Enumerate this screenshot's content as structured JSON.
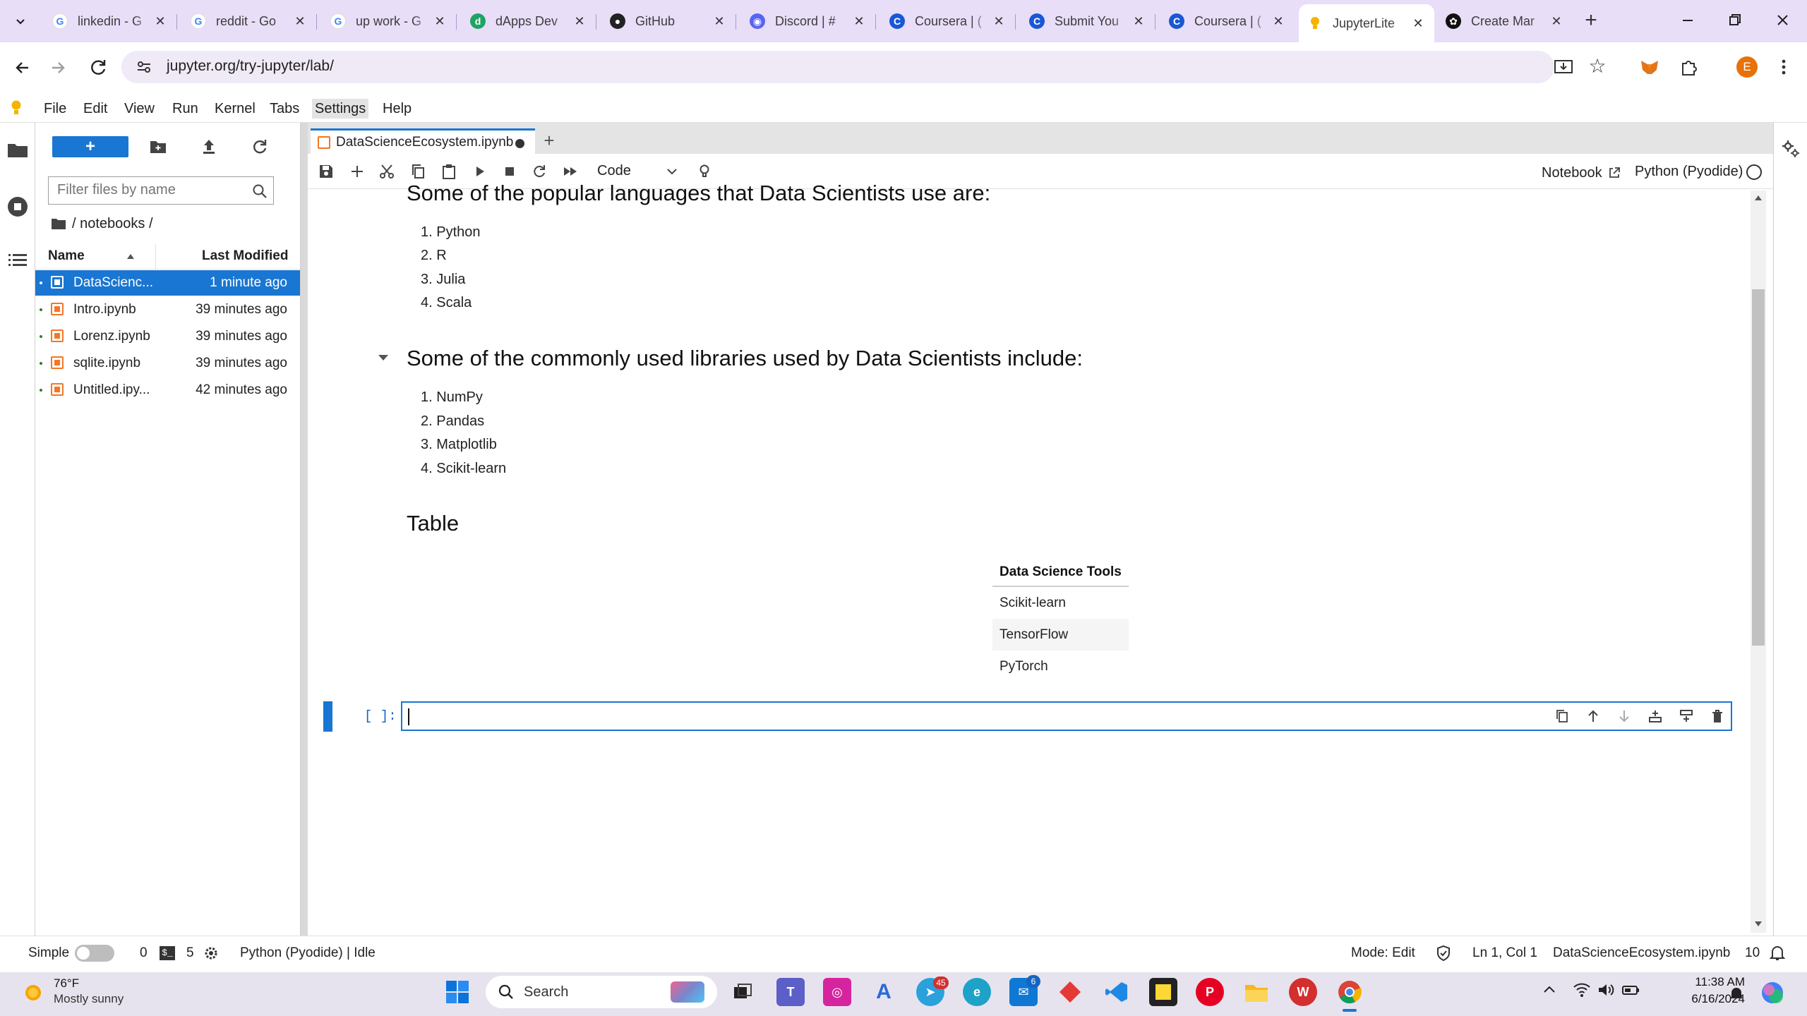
{
  "browser": {
    "tabs": [
      {
        "title": "linkedin - G",
        "icon": "google-icon"
      },
      {
        "title": "reddit - Go",
        "icon": "google-icon"
      },
      {
        "title": "up work - G",
        "icon": "google-icon"
      },
      {
        "title": "dApps Dev",
        "icon": "dapps-icon"
      },
      {
        "title": "GitHub",
        "icon": "github-icon"
      },
      {
        "title": "Discord | #",
        "icon": "discord-icon"
      },
      {
        "title": "Coursera | (",
        "icon": "coursera-icon"
      },
      {
        "title": "Submit You",
        "icon": "coursera-icon"
      },
      {
        "title": "Coursera | (",
        "icon": "coursera-icon"
      },
      {
        "title": "JupyterLite",
        "icon": "jupyter-icon"
      },
      {
        "title": "Create Mar",
        "icon": "chatgpt-icon"
      }
    ],
    "active_tab": 9,
    "url": "jupyter.org/try-jupyter/lab/",
    "profile_initial": "E"
  },
  "menu": [
    "File",
    "Edit",
    "View",
    "Run",
    "Kernel",
    "Tabs",
    "Settings",
    "Help"
  ],
  "filebrowser": {
    "new_label": "+",
    "filter_placeholder": "Filter files by name",
    "breadcrumb": "/ notebooks /",
    "col_name": "Name",
    "col_modified": "Last Modified",
    "files": [
      {
        "name": "DataScienc...",
        "modified": "1 minute ago",
        "selected": true
      },
      {
        "name": "Intro.ipynb",
        "modified": "39 minutes ago",
        "selected": false
      },
      {
        "name": "Lorenz.ipynb",
        "modified": "39 minutes ago",
        "selected": false
      },
      {
        "name": "sqlite.ipynb",
        "modified": "39 minutes ago",
        "selected": false
      },
      {
        "name": "Untitled.ipy...",
        "modified": "42 minutes ago",
        "selected": false
      }
    ]
  },
  "notebook": {
    "tab_title": "DataScienceEcosystem.ipynb",
    "cell_type": "Code",
    "open_in": "Notebook",
    "kernel": "Python (Pyodide)",
    "heading_languages": "Some of the popular languages that Data Scientists use are:",
    "languages": [
      "Python",
      "R",
      "Julia",
      "Scala"
    ],
    "heading_libraries": "Some of the commonly used libraries used by Data Scientists include:",
    "libraries": [
      "NumPy",
      "Pandas",
      "Matplotlib",
      "Scikit-learn"
    ],
    "heading_table": "Table",
    "table_header": "Data Science Tools",
    "table_rows": [
      "Scikit-learn",
      "TensorFlow",
      "PyTorch"
    ],
    "prompt": "[ ]:"
  },
  "statusbar": {
    "mode_label": "Simple",
    "terminals": "0",
    "kernels": "5",
    "kernel_status": "Python (Pyodide) | Idle",
    "mode": "Mode: Edit",
    "cursor": "Ln 1, Col 1",
    "filename": "DataScienceEcosystem.ipynb",
    "notifications": "10"
  },
  "taskbar": {
    "temperature": "76°F",
    "weather": "Mostly sunny",
    "search": "Search",
    "time": "11:38 AM",
    "date": "6/16/2024",
    "badge_telegram": "45",
    "badge_mail": "6"
  },
  "colors": {
    "accent": "#1976d2",
    "tabstrip": "#e8def8",
    "notebook_icon": "#f37726"
  }
}
